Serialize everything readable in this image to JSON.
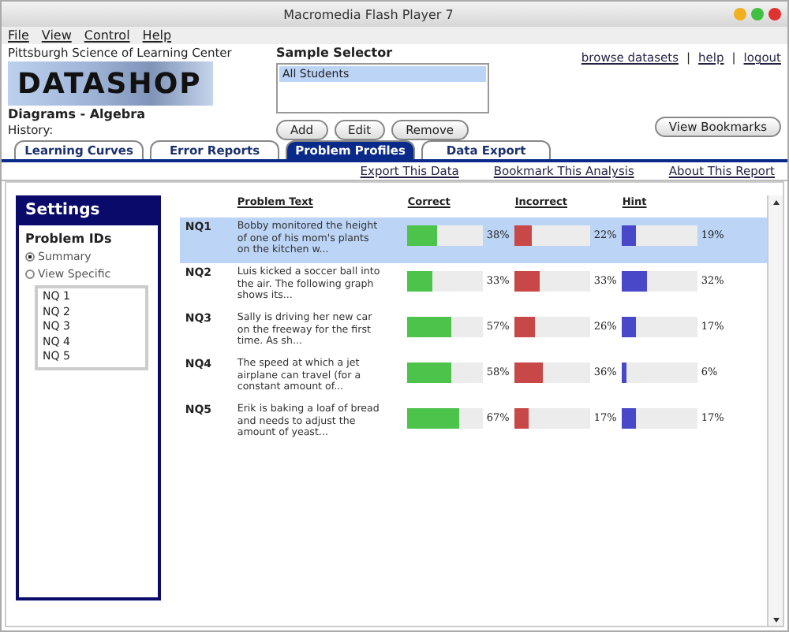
{
  "window": {
    "title": "Macromedia Flash Player 7"
  },
  "menu": [
    "File",
    "View",
    "Control",
    "Help"
  ],
  "header": {
    "org": "Pittsburgh Science of Learning Center",
    "logo": "DATASHOP",
    "dataset": "Diagrams - Algebra",
    "history": "History:"
  },
  "sample_selector": {
    "title": "Sample Selector",
    "items": [
      {
        "label": "All Students",
        "selected": true
      }
    ],
    "buttons": [
      "Add",
      "Edit",
      "Remove"
    ]
  },
  "top_links": [
    "browse datasets",
    "|",
    "help",
    "|",
    "logout"
  ],
  "view_bookmarks": "View Bookmarks",
  "tabs": [
    {
      "label": "Learning Curves",
      "selected": false
    },
    {
      "label": "Error Reports",
      "selected": false
    },
    {
      "label": "Problem Profiles",
      "selected": true
    },
    {
      "label": "Data Export",
      "selected": false
    }
  ],
  "actions": [
    "Export This Data",
    "Bookmark This Analysis",
    "About This Report"
  ],
  "settings": {
    "title": "Settings",
    "section": "Problem IDs",
    "options": [
      {
        "label": "Summary",
        "selected": true
      },
      {
        "label": "View Specific",
        "selected": false
      }
    ],
    "problems": [
      "NQ 1",
      "NQ 2",
      "NQ 3",
      "NQ 4",
      "NQ 5"
    ]
  },
  "table": {
    "columns": [
      "Problem Text",
      "Correct",
      "Incorrect",
      "Hint"
    ],
    "rows": [
      {
        "id": "NQ1",
        "text": "Bobby monitored the height of one of his mom's plants on the kitchen w...",
        "selected": true,
        "correct": {
          "level": 0.38,
          "reading": "38%"
        },
        "incorrect": {
          "level": 0.22,
          "reading": "22%"
        },
        "hint": {
          "level": 0.19,
          "reading": "19%"
        }
      },
      {
        "id": "NQ2",
        "text": "Luis kicked a soccer ball into the air.  The following graph shows its...",
        "selected": false,
        "correct": {
          "level": 0.33,
          "reading": "33%"
        },
        "incorrect": {
          "level": 0.33,
          "reading": "33%"
        },
        "hint": {
          "level": 0.32,
          "reading": "32%"
        }
      },
      {
        "id": "NQ3",
        "text": "Sally is driving her new car on the freeway for the first time.  As sh...",
        "selected": false,
        "correct": {
          "level": 0.57,
          "reading": "57%"
        },
        "incorrect": {
          "level": 0.26,
          "reading": "26%"
        },
        "hint": {
          "level": 0.17,
          "reading": "17%"
        }
      },
      {
        "id": "NQ4",
        "text": "The speed at which a jet airplane can travel (for a constant amount of...",
        "selected": false,
        "correct": {
          "level": 0.58,
          "reading": "58%"
        },
        "incorrect": {
          "level": 0.36,
          "reading": "36%"
        },
        "hint": {
          "level": 0.06,
          "reading": "6%"
        }
      },
      {
        "id": "NQ5",
        "text": "Erik is baking a loaf of bread and needs to adjust the amount of yeast...",
        "selected": false,
        "correct": {
          "level": 0.67,
          "reading": "67%"
        },
        "incorrect": {
          "level": 0.17,
          "reading": "17%"
        },
        "hint": {
          "level": 0.17,
          "reading": "17%"
        }
      }
    ]
  }
}
